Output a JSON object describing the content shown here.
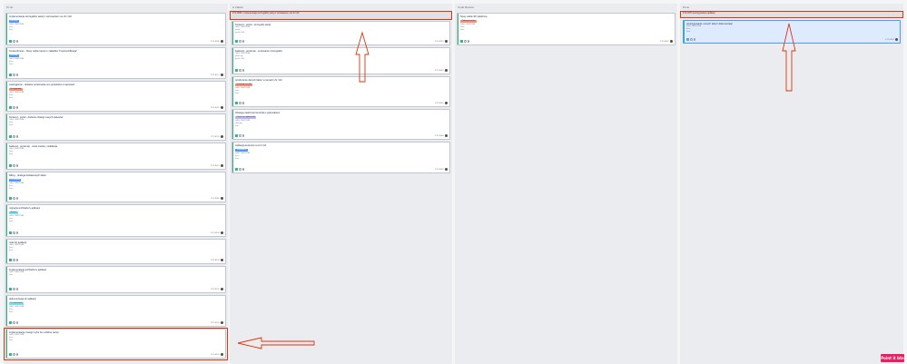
{
  "columns": [
    {
      "title": "To do"
    },
    {
      "title": "w trakcie"
    },
    {
      "title": "Code Review"
    },
    {
      "title": "Done"
    }
  ],
  "todo_cards": [
    {
      "title": "Implementacja szczegółów sekcji z sortowaniem na LN i GK",
      "label": "Backlog",
      "meta": [
        "CALL CENTRUM",
        "Zero",
        "Zero"
      ],
      "key": "KTC-8038"
    },
    {
      "title": "frontend/mess - Nowy widok raportu i zakładka \"Impersonifikacja\"",
      "label": "Backlog",
      "meta": [
        "CALL CENTRUM",
        "Zero",
        "Zero"
      ],
      "key": "KTC-8174"
    },
    {
      "title": "zaokrąglenie - dodanie porównania cen produktów w raportach",
      "label": "Do poprawy",
      "meta": [
        "CALL CENTRUM",
        "Zero",
        "Zero"
      ],
      "key": "KTC-8022"
    },
    {
      "title": "frontend - portal - dodanie obsługi nowych statusów",
      "label": "",
      "meta": [
        "CALL CENTRUM",
        "Zero",
        "Zero"
      ],
      "key": "KTC-8120"
    },
    {
      "title": "backend - portal api - nowe zasoby i walidacja",
      "label": "",
      "meta": [
        "CALL CENTRUM",
        "Zero",
        "Zero"
      ],
      "key": "KTC-8021"
    },
    {
      "title": "billing - obsługa dodatkowych faktur",
      "label": "Do analizy",
      "meta": [
        "CALL CENTRUM",
        "Zero",
        "Zero"
      ],
      "key": "KTC-8060"
    },
    {
      "title": "migracja architektury aplikacji",
      "label": "Analiza",
      "meta": [
        "CALL CENTRUM",
        "Zero",
        "Zero"
      ],
      "key": "KTC-8108"
    },
    {
      "title": "notki do aplikacji",
      "label": "",
      "meta": [
        "CALL CENTRUM",
        "Zero",
        "Zero"
      ],
      "key": "KTC-8134"
    },
    {
      "title": "Implementacja architektury aplikacji",
      "label": "",
      "meta": [
        "CALL CENTRUM",
        "Zero"
      ],
      "key": "KTC-8132"
    },
    {
      "title": "dokumentacja do aplikacji",
      "label": "Do wdrożenia",
      "meta": [
        "CALL CENTRUM",
        "Zero",
        "Zero"
      ],
      "key": "KTC-8124"
    },
    {
      "title": "Implementacja nowego trybu do mobilnej wersji",
      "label": "",
      "meta": [
        "CALL CENTRUM",
        "Zero",
        "Zero"
      ],
      "key": "KTC-8142"
    }
  ],
  "wip": {
    "epic": "KTC-8008 - Implementacja szczegółów sekcji z sortowaniem na LN i GK",
    "cards": [
      {
        "title": "frontend - portal - szczegóły sekcji",
        "label": "",
        "meta": [
          "CALL CENTRUM",
          "portal",
          "portal LCA"
        ],
        "key": "KTC-8015"
      },
      {
        "title": "backend - portal api - sortowanie szczegółów",
        "label": "",
        "meta": [
          "CALL CENTRUM",
          "portal api",
          "portal LCA"
        ],
        "key": "KTC-8012"
      },
      {
        "title": "przeliczenie danych faktur w ramach LN i GK",
        "label": "Oczekuje na QA",
        "meta": [
          "CALL CENTRUM",
          "Zero",
          "Zero"
        ],
        "key": "KTC-8016"
      },
      {
        "title": "Obsługa zależności kontrola z jednostkami",
        "label": "Czeka na odpowiedź",
        "meta": [
          "CALL CENTRUM",
          "Obsługa",
          "Zero"
        ],
        "key": "KTC-8066"
      },
      {
        "title": "Aplikacja kurierów na LN i GK",
        "label": "Testowanie",
        "meta": [
          "CALL CENTRUM",
          "Zero",
          "Zero"
        ],
        "key": "KTC-8081"
      }
    ]
  },
  "review_card": {
    "title": "Nowy widok SP platforma",
    "label": "Zabezpieczone",
    "meta": [
      "CALL CENTRUM",
      "Zero",
      "Zero"
    ],
    "key": "KTC-8067"
  },
  "done": {
    "epic": "KTC-8176 prototypowanie aplikacji",
    "card": {
      "title": "prototypowanie nowych tabel i dokumentacji",
      "meta": [
        "CALL CENTRUM",
        "Zero",
        "Zero"
      ],
      "key": "KTC-8094"
    }
  },
  "feedback_label": "Point it btn",
  "colors": {
    "accent": "#de350b",
    "green": "#36b37e",
    "blue_label": "#4c9aff",
    "red_label": "#ff8f73"
  }
}
